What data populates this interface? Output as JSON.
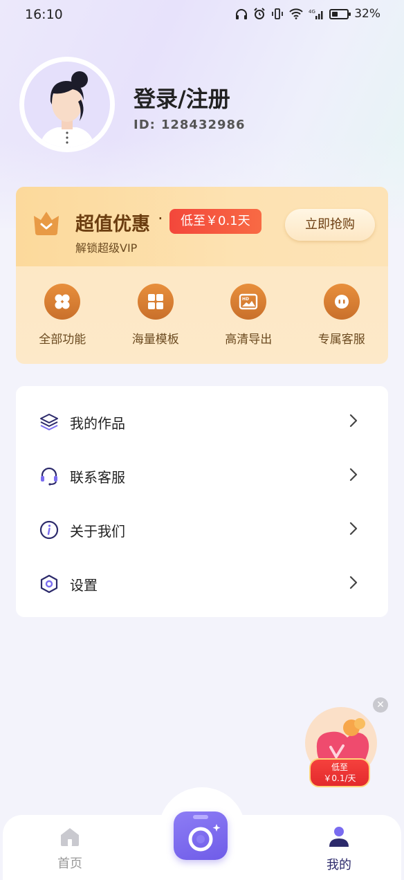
{
  "status_bar": {
    "time": "16:10",
    "battery": "32%"
  },
  "profile": {
    "name": "登录/注册",
    "id_label": "ID:",
    "id_value": "128432986"
  },
  "vip": {
    "title": "超值优惠",
    "dot": "·",
    "badge": "低至￥0.1天",
    "subtitle": "解锁超级VIP",
    "buy_label": "立即抢购",
    "features": [
      {
        "label": "全部功能",
        "icon": "clover-icon"
      },
      {
        "label": "海量模板",
        "icon": "grid-icon"
      },
      {
        "label": "高清导出",
        "icon": "hd-image-icon"
      },
      {
        "label": "专属客服",
        "icon": "headset-icon"
      }
    ]
  },
  "menu": {
    "items": [
      {
        "label": "我的作品",
        "icon": "layers-icon"
      },
      {
        "label": "联系客服",
        "icon": "headset-icon"
      },
      {
        "label": "关于我们",
        "icon": "info-icon"
      },
      {
        "label": "设置",
        "icon": "settings-hexagon-icon"
      }
    ]
  },
  "promo": {
    "close": "✕",
    "line1": "低至",
    "line2": "￥0.1/天"
  },
  "bottom_nav": {
    "home_label": "首页",
    "me_label": "我的"
  },
  "colors": {
    "accent": "#6f5ce8",
    "vip_text": "#6b3d10",
    "badge_red": "#f3473b"
  }
}
